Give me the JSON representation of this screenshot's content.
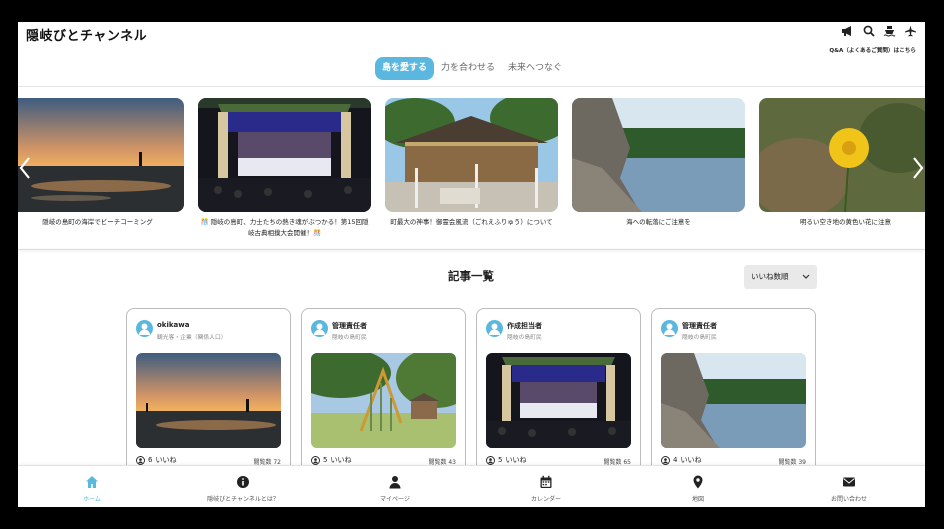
{
  "header": {
    "logo": "隠岐びとチャンネル",
    "qa_link": "Q&A（よくあるご質問）はこちら",
    "icons": [
      "megaphone-icon",
      "search-icon",
      "ship-icon",
      "airplane-icon"
    ]
  },
  "tabs": [
    {
      "label": "島を愛する",
      "active": true
    },
    {
      "label": "力を合わせる",
      "active": false
    },
    {
      "label": "未来へつなぐ",
      "active": false
    }
  ],
  "carousel": [
    {
      "caption": "隠岐の島町の海岸でビーチコーミング"
    },
    {
      "caption": "🎊 隠岐の島町、力士たちの熱き魂がぶつかる！第15回隠岐古典相撲大会開催！🎊"
    },
    {
      "caption": "町最大の神事！御霊会風流（ごれえふりゅう）について"
    },
    {
      "caption": "海への転落にご注意を"
    },
    {
      "caption": "明るい空き地の黄色い花に注意"
    }
  ],
  "articles": {
    "title": "記事一覧",
    "sort_label": "いいね数順",
    "cards": [
      {
        "name": "okikawa",
        "role": "観光客・企業（関係人口）",
        "likes": "6",
        "likes_label": "いいね",
        "views": "閲覧数 72"
      },
      {
        "name": "管理責任者",
        "role": "隠岐の島町民",
        "likes": "5",
        "likes_label": "いいね",
        "views": "閲覧数 43"
      },
      {
        "name": "作成担当者",
        "role": "隠岐の島町民",
        "likes": "5",
        "likes_label": "いいね",
        "views": "閲覧数 65"
      },
      {
        "name": "管理責任者",
        "role": "隠岐の島町民",
        "likes": "4",
        "likes_label": "いいね",
        "views": "閲覧数 39"
      }
    ]
  },
  "bottom_nav": [
    {
      "label": "ホーム",
      "icon": "home-icon",
      "active": true
    },
    {
      "label": "隠岐びとチャンネルとは？",
      "icon": "info-icon",
      "active": false
    },
    {
      "label": "マイページ",
      "icon": "user-icon",
      "active": false
    },
    {
      "label": "カレンダー",
      "icon": "calendar-icon",
      "active": false
    },
    {
      "label": "地図",
      "icon": "map-pin-icon",
      "active": false
    },
    {
      "label": "お問い合わせ",
      "icon": "mail-icon",
      "active": false
    }
  ],
  "colors": {
    "accent": "#5ab8e0",
    "text": "#222222",
    "border": "#bbbbbb"
  }
}
